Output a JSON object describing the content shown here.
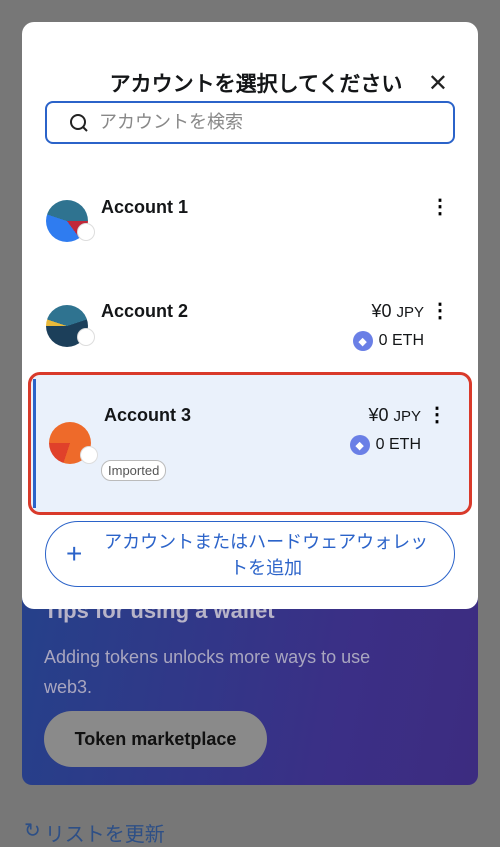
{
  "background": {
    "card_title": "Tips for using a wallet",
    "card_text": "Adding tokens unlocks more ways to use web3.",
    "card_button": "Token marketplace",
    "refresh_label": "リストを更新"
  },
  "modal": {
    "title": "アカウントを選択してください",
    "search_placeholder": "アカウントを検索",
    "add_button": "アカウントまたはハードウェアウォレットを追加"
  },
  "accounts": [
    {
      "name": "Account 1",
      "selected": false
    },
    {
      "name": "Account 2",
      "fiat": "¥0",
      "fiat_unit": "JPY",
      "balance": "0 ETH",
      "selected": false
    },
    {
      "name": "Account 3",
      "fiat": "¥0",
      "fiat_unit": "JPY",
      "balance": "0 ETH",
      "tag": "Imported",
      "selected": true
    }
  ],
  "colors": {
    "accent": "#2b63c9",
    "selected_border": "#d93a2b",
    "selected_bg": "#eaf1fb"
  }
}
